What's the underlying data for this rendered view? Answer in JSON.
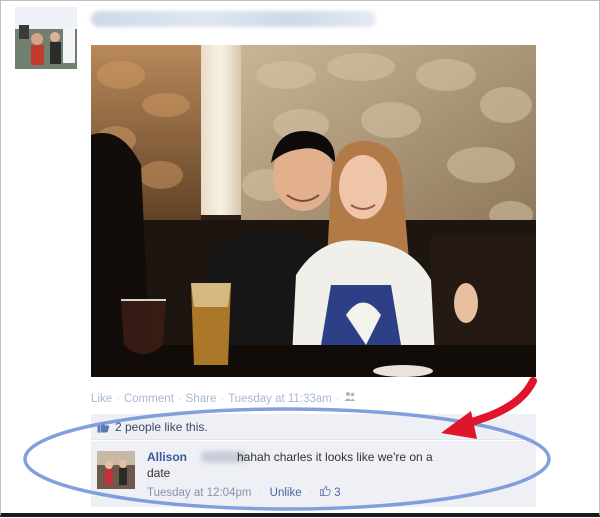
{
  "post": {
    "actions": {
      "like": "Like",
      "comment": "Comment",
      "share": "Share",
      "timestamp": "Tuesday at 11:33am",
      "separator": "·"
    },
    "likes_text": "2 people like this."
  },
  "comment": {
    "author": "Allison",
    "text_line1": "hahah charles it looks like we're on a",
    "text_line2": "date",
    "timestamp": "Tuesday at 12:04pm",
    "unlike": "Unlike",
    "like_count": "3"
  },
  "icons": {
    "like": "thumbs-up-icon",
    "audience": "friends-icon"
  },
  "colors": {
    "link_blue": "#3b5998",
    "highlight_circle": "#6b8fd6",
    "annotation_arrow": "#e0142b"
  }
}
